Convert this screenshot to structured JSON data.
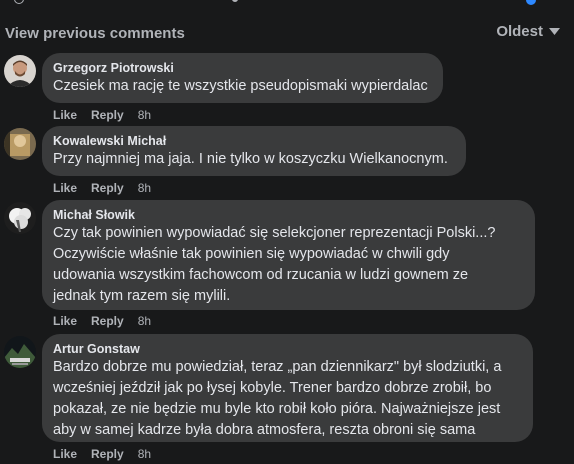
{
  "header": {
    "view_previous": "View previous comments",
    "sort_label": "Oldest"
  },
  "colors": {
    "background": "#18191a",
    "bubble": "#3a3b3c",
    "text": "#e4e6eb",
    "muted": "#b0b3b8"
  },
  "comments": [
    {
      "author": "Grzegorz Piotrowski",
      "text": "Czesiek ma rację te wszystkie pseudopismaki wypierdalac",
      "like": "Like",
      "reply": "Reply",
      "time": "8h"
    },
    {
      "author": "Kowalewski Michał",
      "text": "Przy najmniej ma jaja. I nie tylko w koszyczku Wielkanocnym.",
      "like": "Like",
      "reply": "Reply",
      "time": "8h"
    },
    {
      "author": "Michał Słowik",
      "text": "Czy tak powinien wypowiadać się selekcjoner reprezentacji Polski...?\nOczywiście właśnie tak powinien się wypowiadać w chwili gdy\nudowania wszystkim fachowcom od rzucania w ludzi gownem ze\njednak tym razem się mylili.",
      "like": "Like",
      "reply": "Reply",
      "time": "8h"
    },
    {
      "author": "Artur Gonstaw",
      "text": "Bardzo dobrze mu powiedział, teraz „pan dziennikarz\" był slodziutki, a\nwcześniej jeździł jak po łysej kobyle. Trener bardzo dobrze zrobił, bo\npokazał, ze nie będzie mu byle kto robił koło pióra. Najważniejsze jest\naby w samej kadrze była dobra atmosfera, reszta obroni się sama",
      "like": "Like",
      "reply": "Reply",
      "time": "8h"
    }
  ]
}
